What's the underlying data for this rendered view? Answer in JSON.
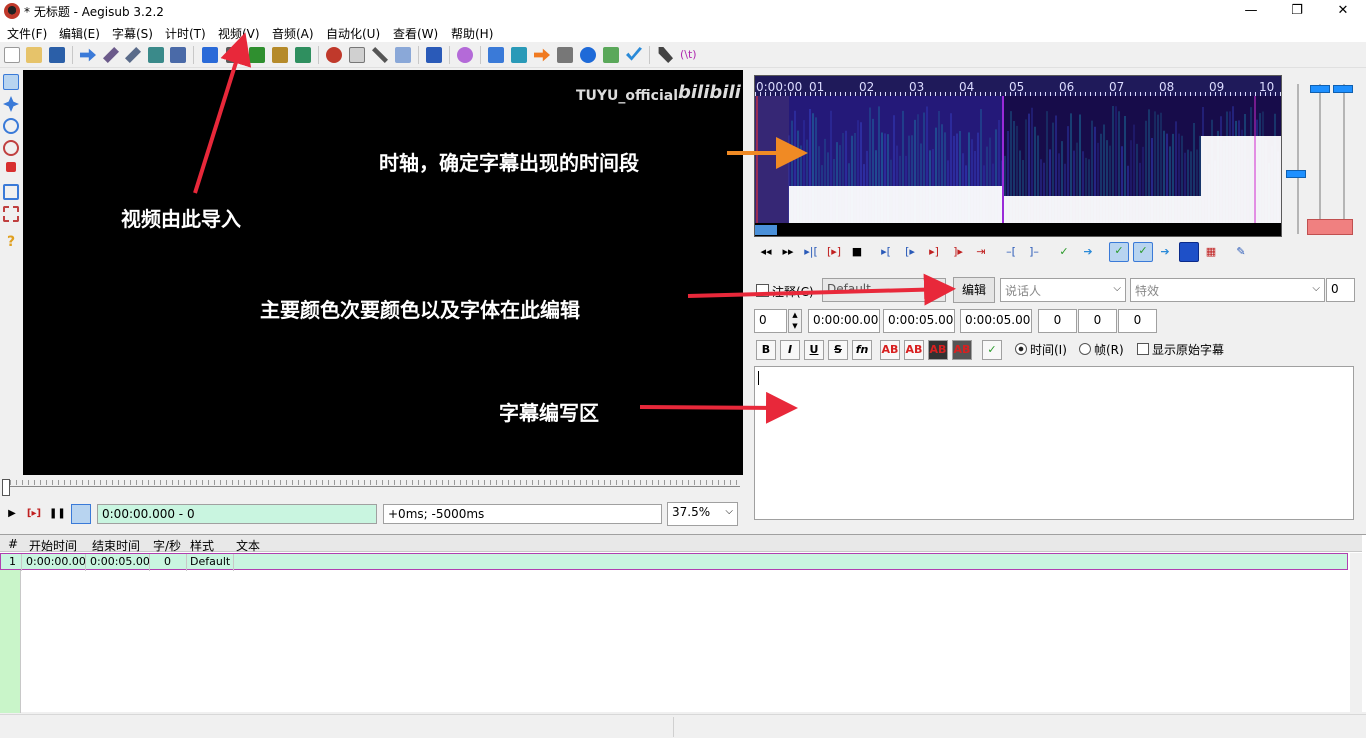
{
  "window": {
    "title": "* 无标题 - Aegisub 3.2.2"
  },
  "menu": [
    "文件(F)",
    "编辑(E)",
    "字幕(S)",
    "计时(T)",
    "视频(V)",
    "音频(A)",
    "自动化(U)",
    "查看(W)",
    "帮助(H)"
  ],
  "video": {
    "watermark": "TUYU_official",
    "watermark_brand": "bilibili"
  },
  "annotations": {
    "video_import": "视频由此导入",
    "timeline": "时轴，确定字幕出现的时间段",
    "style_edit": "主要颜色次要颜色以及字体在此编辑",
    "subtitle_area": "字幕编写区"
  },
  "playback": {
    "time": "0:00:00.000 - 0",
    "offset": "+0ms; -5000ms",
    "zoom": "37.5%"
  },
  "audio": {
    "ruler": [
      "0:00:00",
      "01",
      "02",
      "03",
      "04",
      "05",
      "06",
      "07",
      "08",
      "09",
      "10"
    ]
  },
  "editor": {
    "comment_label": "注释(C)",
    "style": "Default",
    "edit_button": "编辑",
    "actor_placeholder": "说话人",
    "effect_placeholder": "特效",
    "layer_right": "0",
    "layer": "0",
    "start": "0:00:00.00",
    "end": "0:00:05.00",
    "duration": "0:00:05.00",
    "margin_l": "0",
    "margin_r": "0",
    "margin_v": "0",
    "fmt_bold": "B",
    "fmt_italic": "I",
    "fmt_underline": "U",
    "fmt_strike": "S",
    "fmt_font": "fn",
    "color_label": "AB",
    "radio_time": "时间(I)",
    "radio_frame": "帧(R)",
    "show_original": "显示原始字幕"
  },
  "grid": {
    "headers": [
      "#",
      "开始时间",
      "结束时间",
      "字/秒",
      "样式",
      "文本"
    ],
    "rows": [
      {
        "num": "1",
        "start": "0:00:00.00",
        "end": "0:00:05.00",
        "cps": "0",
        "style": "Default",
        "text": ""
      }
    ]
  },
  "colors": {
    "accent": "#1e90ff",
    "grid_active_row": "#c9f5e0",
    "annotation_arrow": "#e8283a",
    "timeline_arrow": "#f08a24"
  }
}
